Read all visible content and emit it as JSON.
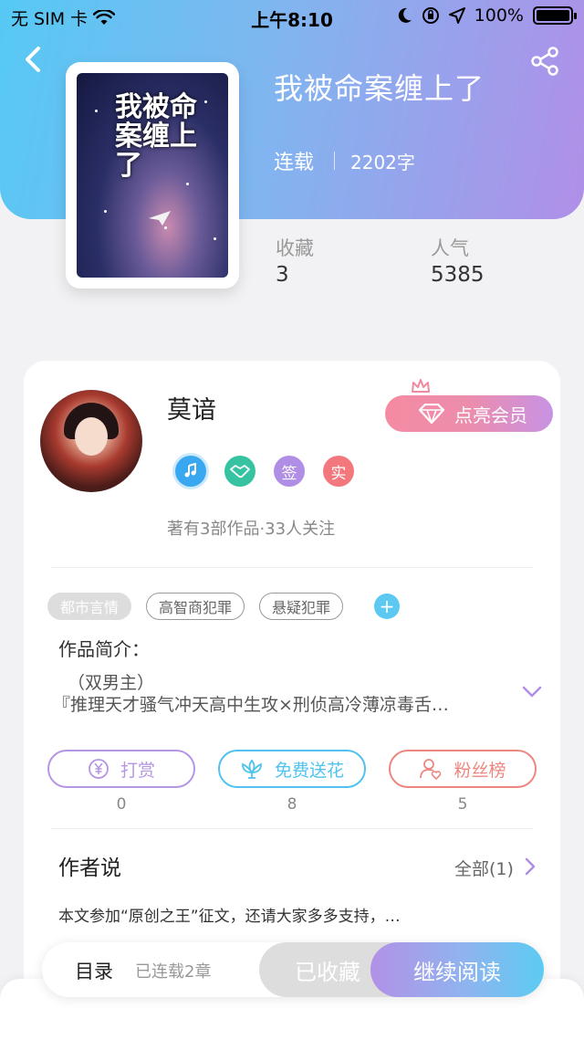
{
  "status_bar": {
    "carrier": "无 SIM 卡",
    "time": "上午8:10",
    "battery": "100%"
  },
  "book": {
    "title": "我被命案缠上了",
    "cover_title": "我被命案缠上了",
    "status": "连载",
    "word_count": "2202字",
    "stats": [
      {
        "label": "收藏",
        "value": "3"
      },
      {
        "label": "人气",
        "value": "5385"
      }
    ]
  },
  "author": {
    "name": "莫谙",
    "vip_button": "点亮会员",
    "badges": [
      {
        "icon": "music-note-icon",
        "text": "",
        "color": "#3aa8f0"
      },
      {
        "icon": "handshake-icon",
        "text": "",
        "color": "#37c3a2"
      },
      {
        "icon": "",
        "text": "签",
        "color": "#b08ee6"
      },
      {
        "icon": "",
        "text": "实",
        "color": "#f2787d"
      }
    ],
    "meta": "著有3部作品·33人关注"
  },
  "tags": [
    "都市言情",
    "高智商犯罪",
    "悬疑犯罪"
  ],
  "intro": {
    "title": "作品简介：",
    "line1": "（双男主）",
    "line2": "『推理天才骚气冲天高中生攻×刑侦高冷薄凉毒舌…"
  },
  "actions": [
    {
      "label": "打赏",
      "count": "0",
      "icon": "yen-coin-icon",
      "color": "#b595e4"
    },
    {
      "label": "免费送花",
      "count": "8",
      "icon": "lotus-icon",
      "color": "#4fc3ee"
    },
    {
      "label": "粉丝榜",
      "count": "5",
      "icon": "fans-icon",
      "color": "#ee8680"
    }
  ],
  "author_say": {
    "title": "作者说",
    "all_link": "全部(1)",
    "text": "本文参加“原创之王”征文，还请大家多多支持，…"
  },
  "bottom_bar": {
    "toc_label": "目录",
    "toc_status": "已连载2章",
    "collected_button": "已收藏",
    "read_button": "继续阅读"
  }
}
